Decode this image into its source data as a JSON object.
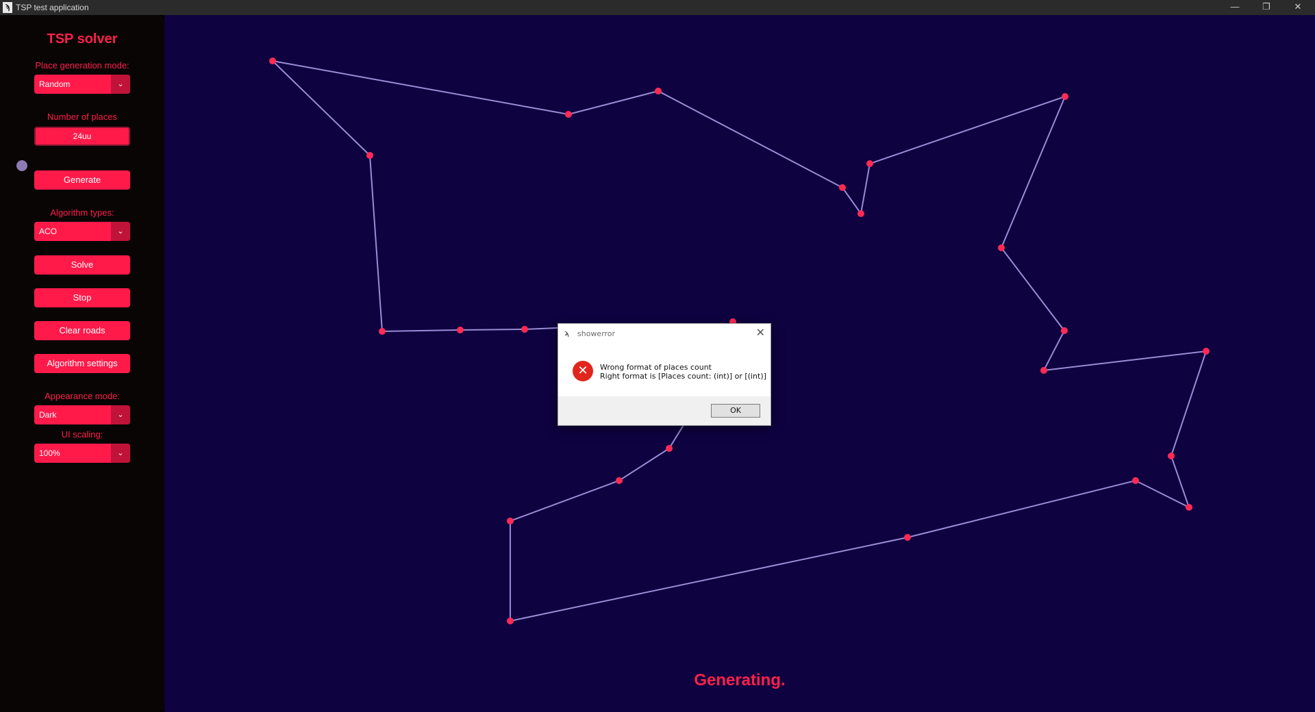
{
  "window": {
    "title": "TSP test application",
    "icon": "tsp-app-icon",
    "controls": {
      "minimize": "—",
      "restore": "❐",
      "close": "✕"
    }
  },
  "sidebar": {
    "title": "TSP solver",
    "place_generation_label": "Place generation mode:",
    "place_generation_value": "Random",
    "number_of_places_label": "Number of places",
    "number_of_places_value": "24uu",
    "generate_label": "Generate",
    "algorithm_types_label": "Algorithm types:",
    "algorithm_types_value": "ACO",
    "solve_label": "Solve",
    "stop_label": "Stop",
    "clear_roads_label": "Clear roads",
    "algorithm_settings_label": "Algorithm settings",
    "appearance_mode_label": "Appearance mode:",
    "appearance_mode_value": "Dark",
    "ui_scaling_label": "UI scaling:",
    "ui_scaling_value": "100%"
  },
  "canvas": {
    "status_text": "Generating.",
    "colors": {
      "background": "#0e0240",
      "road": "#9b8dd6",
      "place": "#ff2b55"
    }
  },
  "dialog": {
    "title": "showerror",
    "message_line1": "Wrong format of places count",
    "message_line2": "Right format is [Places count: (int)] or [(int)]",
    "ok_label": "OK",
    "icon": "error-icon"
  },
  "colors": {
    "accent": "#ff1a4a",
    "sidebar_bg": "#0a0505",
    "titlebar_bg": "#2b2b2b"
  }
}
